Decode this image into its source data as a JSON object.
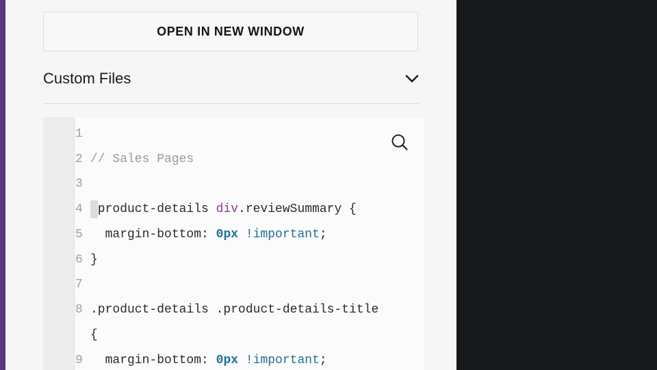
{
  "panel": {
    "open_button_label": "OPEN IN NEW WINDOW",
    "section_title": "Custom Files"
  },
  "editor": {
    "lines": [
      {
        "num": "1",
        "text": ""
      },
      {
        "num": "2",
        "text": "// Sales Pages"
      },
      {
        "num": "3",
        "text": ""
      },
      {
        "num": "4",
        "selector": ".product-details ",
        "tag": "div",
        "rest": ".reviewSummary {"
      },
      {
        "num": "5",
        "prop": "  margin-bottom: ",
        "value": "0px",
        "imp": " !important",
        "end": ";"
      },
      {
        "num": "6",
        "text": "}"
      },
      {
        "num": "7",
        "text": ""
      },
      {
        "num": "8",
        "text": ".product-details .product-details-title"
      },
      {
        "num": "",
        "text": "{"
      },
      {
        "num": "9",
        "prop": "  margin-bottom: ",
        "value": "0px",
        "imp": " !important",
        "end": ";"
      }
    ]
  },
  "icons": {
    "chevron": "chevron-down-icon",
    "search": "search-icon"
  },
  "colors": {
    "accent_strip": "#5a3580",
    "panel_bg": "#f6f6f6",
    "dark_bg": "#17191b",
    "keyword": "#1f6f9a",
    "tag": "#8a3a8e",
    "comment": "#9a9a9a"
  }
}
